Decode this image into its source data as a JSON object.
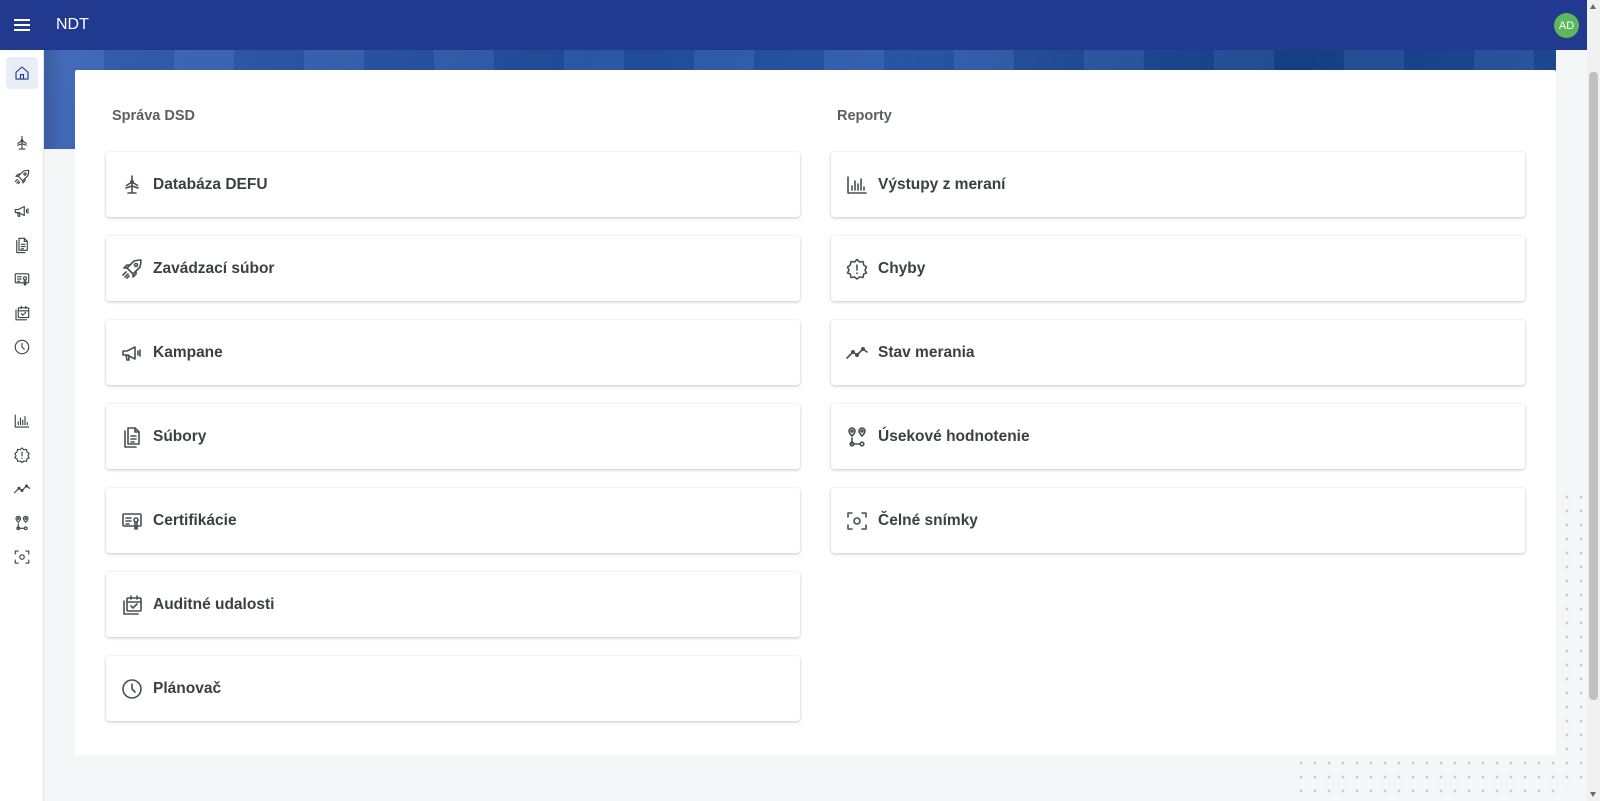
{
  "header": {
    "app_title": "NDT",
    "avatar_initials": "AD",
    "bar_color": "#213a8f",
    "avatar_color": "#5cb85c"
  },
  "sidebar": {
    "items": [
      {
        "icon": "home-icon",
        "active": true
      },
      {
        "icon": "wind-turbine-icon"
      },
      {
        "icon": "rocket-icon"
      },
      {
        "icon": "megaphone-icon"
      },
      {
        "icon": "files-icon"
      },
      {
        "icon": "certificate-icon"
      },
      {
        "icon": "calendar-check-icon"
      },
      {
        "icon": "clock-icon"
      },
      {
        "icon": "bar-chart-icon"
      },
      {
        "icon": "error-badge-icon"
      },
      {
        "icon": "trend-line-icon"
      },
      {
        "icon": "route-pins-icon"
      },
      {
        "icon": "snapshot-icon"
      }
    ]
  },
  "sprava": {
    "title": "Správa DSD",
    "tiles": [
      {
        "label": "Databáza DEFU",
        "icon": "wind-turbine-icon"
      },
      {
        "label": "Zavádzací súbor",
        "icon": "rocket-icon"
      },
      {
        "label": "Kampane",
        "icon": "megaphone-icon"
      },
      {
        "label": "Súbory",
        "icon": "files-icon"
      },
      {
        "label": "Certifikácie",
        "icon": "certificate-icon"
      },
      {
        "label": "Auditné udalosti",
        "icon": "calendar-check-icon"
      },
      {
        "label": "Plánovač",
        "icon": "clock-icon"
      }
    ]
  },
  "reporty": {
    "title": "Reporty",
    "tiles": [
      {
        "label": "Výstupy z meraní",
        "icon": "bar-chart-icon"
      },
      {
        "label": "Chyby",
        "icon": "error-badge-icon"
      },
      {
        "label": "Stav merania",
        "icon": "trend-line-icon"
      },
      {
        "label": "Úsekové hodnotenie",
        "icon": "route-pins-icon"
      },
      {
        "label": "Čelné snímky",
        "icon": "snapshot-icon"
      }
    ]
  }
}
